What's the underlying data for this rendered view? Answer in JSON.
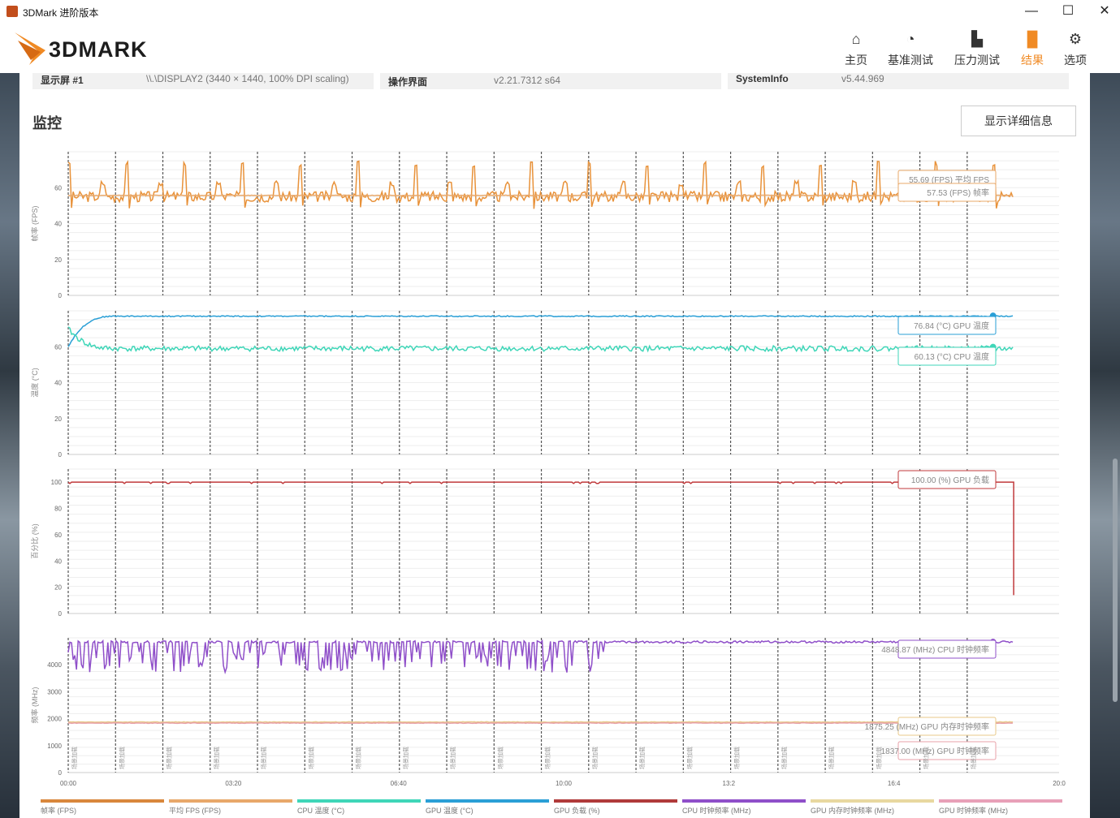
{
  "window": {
    "title": "3DMark 进阶版本",
    "minimize": "—",
    "maximize": "☐",
    "close": "✕"
  },
  "header": {
    "logo_text": "3DMARK",
    "nav": [
      {
        "label": "主页",
        "icon": "home-icon",
        "glyph": "⌂"
      },
      {
        "label": "基准测试",
        "icon": "gauge-icon",
        "glyph": "◔"
      },
      {
        "label": "压力测试",
        "icon": "bar-chart-icon",
        "glyph": "▙"
      },
      {
        "label": "结果",
        "icon": "results-icon",
        "glyph": "▐▌",
        "active": true
      },
      {
        "label": "选项",
        "icon": "gear-icon",
        "glyph": "⚙"
      }
    ]
  },
  "info": {
    "display_key": "显示屏 #1",
    "display_value": "\\\\.\\DISPLAY2 (3440 × 1440, 100% DPI scaling)",
    "ui_key": "操作界面",
    "ui_value": "v2.21.7312 s64",
    "sysinfo_key": "SystemInfo",
    "sysinfo_value": "v5.44.969"
  },
  "monitor": {
    "title": "监控",
    "detail_button": "显示详细信息"
  },
  "colors": {
    "fps": "#e8923a",
    "avg_fps": "#e8a86a",
    "cpu_temp": "#3fd6b8",
    "gpu_temp": "#2a9fd6",
    "gpu_load": "#c0393b",
    "cpu_clock": "#8f4fc9",
    "gpu_mem_clock": "#e8c98a",
    "gpu_clock": "#e8a0a8",
    "accent": "#f08a24"
  },
  "chart_data": [
    {
      "type": "line",
      "ylabel": "帧率 (FPS)",
      "yticks": [
        0,
        20,
        40,
        60
      ],
      "ylim": [
        0,
        80
      ],
      "series": [
        {
          "name": "帧率 (FPS)",
          "pattern": "sawtooth",
          "base": 55,
          "spike": 75,
          "min": 48,
          "period_s": 70
        },
        {
          "name": "平均 FPS (FPS)",
          "constant": 55.69
        }
      ],
      "callouts": [
        "55.69 (FPS) 平均 FPS",
        "57.53 (FPS) 帧率"
      ]
    },
    {
      "type": "line",
      "ylabel": "温度 (°C)",
      "yticks": [
        0,
        20,
        40,
        60
      ],
      "ylim": [
        0,
        80
      ],
      "series": [
        {
          "name": "GPU 温度 (°C)",
          "start": 60,
          "plateau": 77
        },
        {
          "name": "CPU 温度 (°C)",
          "start": 70,
          "plateau": 59
        }
      ],
      "callouts": [
        "76.84 (°C) GPU 温度",
        "60.13 (°C) CPU 温度"
      ]
    },
    {
      "type": "line",
      "ylabel": "百分比 (%)",
      "yticks": [
        0,
        20,
        40,
        60,
        80,
        100
      ],
      "ylim": [
        0,
        110
      ],
      "series": [
        {
          "name": "GPU 负载 (%)",
          "constant": 100,
          "end_drop": 14
        }
      ],
      "callouts": [
        "100.00 (%) GPU 负载"
      ]
    },
    {
      "type": "line",
      "ylabel": "频率 (MHz)",
      "yticks": [
        0,
        1000,
        2000,
        3000,
        4000
      ],
      "ylim": [
        0,
        5000
      ],
      "series": [
        {
          "name": "CPU 时钟频率 (MHz)",
          "base": 4848,
          "dip": 3700
        },
        {
          "name": "GPU 内存时钟频率 (MHz)",
          "constant": 1875
        },
        {
          "name": "GPU 时钟频率 (MHz)",
          "constant": 1837
        }
      ],
      "callouts": [
        "4848.87 (MHz) CPU 时钟频率",
        "1875.25 (MHz) GPU 内存时钟频率",
        "1837.00 (MHz) GPU 时钟频率"
      ]
    }
  ],
  "x_axis": {
    "ticks": [
      "00:00",
      "03:20",
      "06:40",
      "10:00",
      "13:2",
      "16:4",
      "20:0"
    ],
    "tick_seconds": [
      0,
      200,
      400,
      600,
      800,
      1000,
      1200
    ],
    "max_seconds": 1200,
    "marker_label": "场景加载"
  },
  "legend": [
    {
      "label": "帧率 (FPS)",
      "color": "#d9873c"
    },
    {
      "label": "平均 FPS (FPS)",
      "color": "#e8a86a"
    },
    {
      "label": "CPU 温度 (°C)",
      "color": "#3fd6b8"
    },
    {
      "label": "GPU 温度 (°C)",
      "color": "#2a9fd6"
    },
    {
      "label": "GPU 负载 (%)",
      "color": "#b03a3a"
    },
    {
      "label": "CPU 时钟频率 (MHz)",
      "color": "#8f4fc9"
    },
    {
      "label": "GPU 内存时钟频率 (MHz)",
      "color": "#e8d8a0"
    },
    {
      "label": "GPU 时钟频率 (MHz)",
      "color": "#e8a0b8"
    }
  ]
}
